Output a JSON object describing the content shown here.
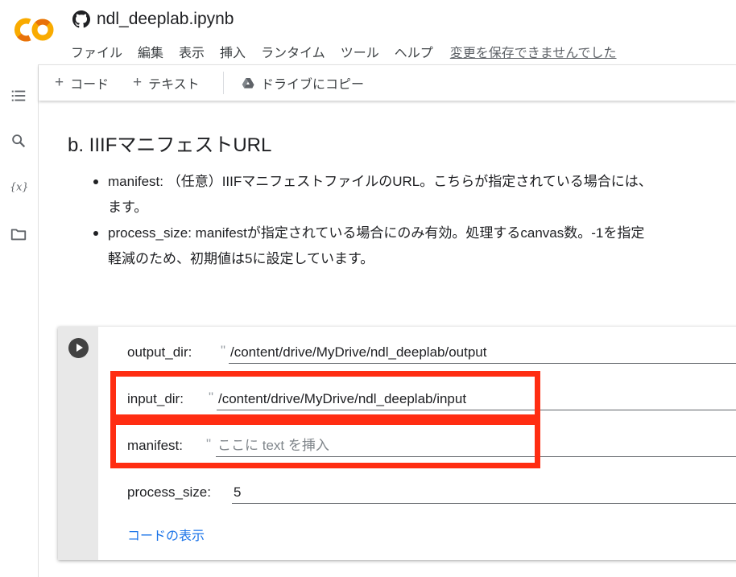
{
  "notebook": {
    "title": "ndl_deeplab.ipynb"
  },
  "menu": {
    "items": [
      "ファイル",
      "編集",
      "表示",
      "挿入",
      "ランタイム",
      "ツール",
      "ヘルプ"
    ],
    "unsaved_notice": "変更を保存できませんでした"
  },
  "toolbar": {
    "add_code": "コード",
    "add_text": "テキスト",
    "copy_to_drive": "ドライブにコピー"
  },
  "text_cell": {
    "heading": "b. IIIFマニフェストURL",
    "bullets": [
      "manifest: （任意）IIIFマニフェストファイルのURL。こちらが指定されている場合には、",
      "ます。",
      "process_size: manifestが指定されている場合にのみ有効。処理するcanvas数。-1を指定",
      "軽減のため、初期値は5に設定しています。"
    ]
  },
  "form": {
    "output_dir": {
      "label": "output_dir:",
      "value": "/content/drive/MyDrive/ndl_deeplab/output"
    },
    "input_dir": {
      "label": "input_dir:",
      "value": "/content/drive/MyDrive/ndl_deeplab/input"
    },
    "manifest": {
      "label": "manifest:",
      "placeholder": "ここに text を挿入"
    },
    "process_size": {
      "label": "process_size:",
      "value": "5"
    },
    "quote": "\"",
    "show_code": "コードの表示"
  },
  "colors": {
    "highlight": "#ff2d12",
    "link": "#1a73e8",
    "colab_orange": "#f9ab00",
    "colab_dark_orange": "#e8710a"
  },
  "icons": [
    "colab-logo-icon",
    "github-icon",
    "toc-icon",
    "search-icon",
    "variables-icon",
    "folder-icon",
    "drive-icon",
    "play-icon"
  ]
}
